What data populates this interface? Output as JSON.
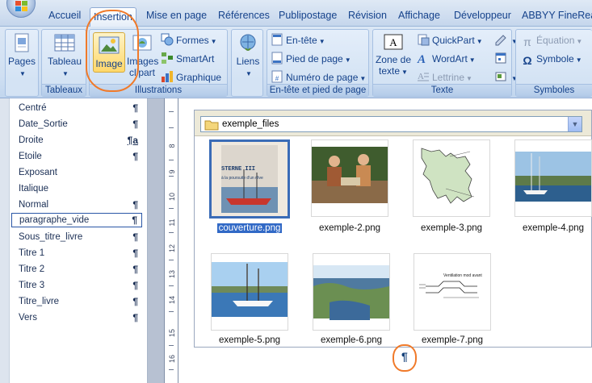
{
  "tabs": [
    {
      "label": "Accueil"
    },
    {
      "label": "Insertion",
      "active": true
    },
    {
      "label": "Mise en page"
    },
    {
      "label": "Références"
    },
    {
      "label": "Publipostage"
    },
    {
      "label": "Révision"
    },
    {
      "label": "Affichage"
    },
    {
      "label": "Développeur"
    },
    {
      "label": "ABBYY FineReade"
    }
  ],
  "ribbon": {
    "pages": {
      "label": "Pages"
    },
    "tableaux": {
      "group_label": "Tableaux",
      "tableau_label": "Tableau"
    },
    "illustrations": {
      "group_label": "Illustrations",
      "image_label": "Image",
      "images_clipart_line1": "Images",
      "images_clipart_line2": "clipart",
      "formes_label": "Formes",
      "smartart_label": "SmartArt",
      "graphique_label": "Graphique"
    },
    "liens": {
      "label": "Liens"
    },
    "entete": {
      "group_label": "En-tête et pied de page",
      "entete_label": "En-tête",
      "pied_label": "Pied de page",
      "numero_label": "Numéro de page"
    },
    "texte": {
      "group_label": "Texte",
      "zone_line1": "Zone de",
      "zone_line2": "texte",
      "quickpart_label": "QuickPart",
      "wordart_label": "WordArt",
      "lettrine_label": "Lettrine"
    },
    "symboles": {
      "group_label": "Symboles",
      "equation_label": "Équation",
      "symbole_label": "Symbole"
    }
  },
  "styles": [
    {
      "name": "Centré",
      "mark": "¶"
    },
    {
      "name": "Date_Sortie",
      "mark": "¶"
    },
    {
      "name": "Droite",
      "mark": "¶a"
    },
    {
      "name": "Etoile",
      "mark": "¶"
    },
    {
      "name": "Exposant",
      "mark": ""
    },
    {
      "name": "Italique",
      "mark": ""
    },
    {
      "name": "Normal",
      "mark": "¶"
    },
    {
      "name": "paragraphe_vide",
      "mark": "¶",
      "selected": true
    },
    {
      "name": "Sous_titre_livre",
      "mark": "¶"
    },
    {
      "name": "Titre 1",
      "mark": "¶"
    },
    {
      "name": "Titre 2",
      "mark": "¶"
    },
    {
      "name": "Titre 3",
      "mark": "¶"
    },
    {
      "name": "Titre_livre",
      "mark": "¶"
    },
    {
      "name": "Vers",
      "mark": "¶"
    }
  ],
  "ruler_numbers": [
    "8",
    "9",
    "10",
    "11",
    "12",
    "13",
    "14",
    "15",
    "16"
  ],
  "browser": {
    "folder": "exemple_files",
    "files": [
      {
        "name": "couverture.png",
        "selected": true,
        "cover_title": "STERNE III",
        "cover_subtitle": "à la poursuite d'un rêve"
      },
      {
        "name": "exemple-2.png"
      },
      {
        "name": "exemple-3.png"
      },
      {
        "name": "exemple-4.png"
      },
      {
        "name": "exemple-5.png"
      },
      {
        "name": "exemple-6.png"
      },
      {
        "name": "exemple-7.png",
        "doc_text": "Ventilation mod avant"
      }
    ]
  },
  "pilcrow": "¶",
  "colors": {
    "accent": "#3169c6",
    "annotation": "#f07a2a",
    "ribbon_text": "#15428b"
  }
}
